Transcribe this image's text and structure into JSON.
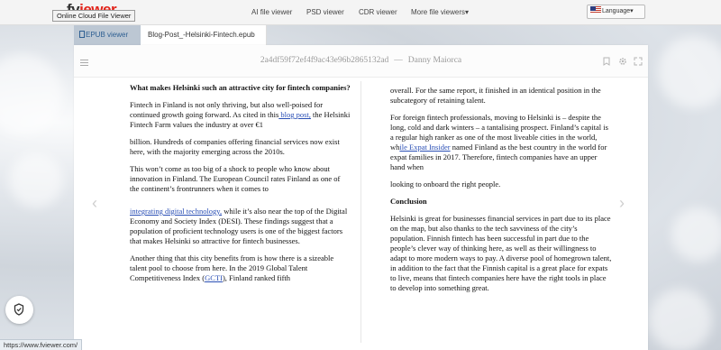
{
  "header": {
    "logo_prefix": "fv",
    "logo_suffix": "iewer",
    "tooltip": "Online Cloud File Viewer",
    "nav": [
      {
        "label": "AI file viewer"
      },
      {
        "label": "PSD viewer"
      },
      {
        "label": "CDR viewer"
      },
      {
        "label": "More file viewers"
      }
    ],
    "more_caret": "▾",
    "language": "Language",
    "language_caret": "▾"
  },
  "tabs": {
    "viewer": "EPUB viewer",
    "file": "Blog-Post_-Helsinki-Fintech.epub"
  },
  "doc": {
    "id": "2a4df59f72ef4f9ac43e96b2865132ad",
    "author": "Danny Maiorca",
    "separator": "—"
  },
  "left_column": {
    "heading": "What makes Helsinki such an attractive city for fintech companies?",
    "p1_before": "Fintech in Finland is not only thriving, but also well-poised for continued growth going forward. As cited in this",
    "p1_link": " blog post,",
    "p1_after": " the Helsinki Fintech Farm values the industry at over €1",
    "p2": "billion. Hundreds of companies offering financial services now exist here, with the majority emerging across the 2010s.",
    "p3": "This won’t come as too big of a shock to people who know about innovation in Finland. The European Council rates Finland as one of the continent’s frontrunners when it comes to",
    "p4_link": "integrating digital technology,",
    "p4_after": " while it’s also near the top of the Digital Economy and Society Index (DESI). These findings suggest that a population of proficient technology users is one of the biggest factors that makes Helsinki so attractive for fintech businesses.",
    "p5_before": "Another thing that this city benefits from is how there is a sizeable talent pool to choose from here. In the 2019 Global Talent Competitiveness Index (",
    "p5_link": "GCTI",
    "p5_after": "), Finland ranked fifth"
  },
  "right_column": {
    "p1": "overall. For the same report, it finished in an identical position in the subcategory of retaining talent.",
    "p2_before": "For foreign fintech professionals, moving to Helsinki is – despite the long, cold and dark winters – a tantalising prospect. Finland’s capital is a regular high ranker as one of the most liveable cities in the world, wh",
    "p2_link": "ile Expat Insider",
    "p2_after": " named Finland as the best country in the world for expat families in 2017. Therefore, fintech companies have an upper hand when",
    "p3": "looking to onboard the right people.",
    "heading": "Conclusion",
    "p4": "Helsinki is great for businesses financial services in part due to its place on the map, but also thanks to the tech savviness of the city’s population. Finnish fintech has been successful in part due to the people’s clever way of thinking here, as well as their willingness to adapt to more modern ways to pay. A diverse pool of homegrown talent, in addition to the fact that the Finnish capital is a great place for expats to live, means that fintech companies here have the right tools in place to develop into something great."
  },
  "status_bar": {
    "url": "https://www.fviewer.com/"
  },
  "icons": {
    "prev": "‹",
    "next": "›"
  }
}
